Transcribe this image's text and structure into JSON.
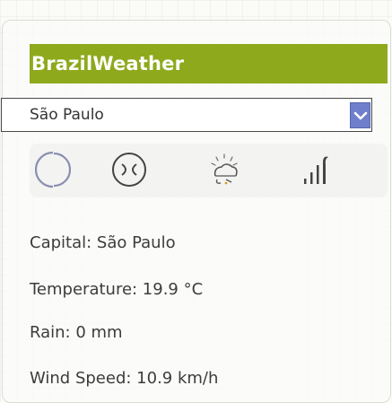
{
  "app": {
    "title": "BrazilWeather"
  },
  "city_select": {
    "selected": "São Paulo"
  },
  "icons": [
    "night-clear-icon",
    "cloudy-icon",
    "sun-cloud-icon",
    "signal-strength-icon"
  ],
  "info": {
    "capital": "Capital: São Paulo",
    "temperature": "Temperature: 19.9 °C",
    "rain": "Rain: 0 mm",
    "wind": "Wind Speed: 10.9 km/h"
  },
  "colors": {
    "header_bg": "#8ea91c",
    "dropdown_btn": "#6f7fcb"
  }
}
